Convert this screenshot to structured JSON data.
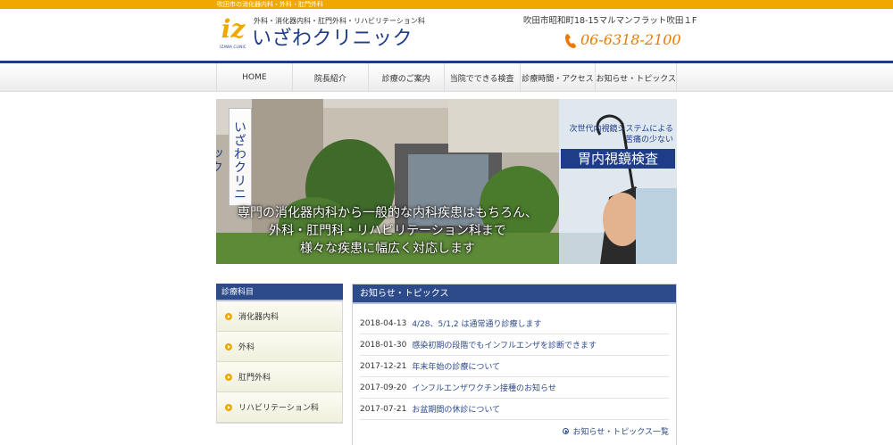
{
  "topbar": {
    "text": "吹田市の消化器内科・外科・肛門外科"
  },
  "header": {
    "logo_mark": "iz",
    "logo_en": "IZAWA CLINIC",
    "subtitle": "外科・消化器内科・肛門外科・リハビリテーション科",
    "clinic_name": "いざわクリニック",
    "address": "吹田市昭和町18-15マルマンフラット吹田１F",
    "phone": "06-6318-2100",
    "phone_icon": "phone-icon"
  },
  "colors": {
    "brand_navy": "#1e3c88",
    "accent_orange": "#f0a800",
    "phone_orange": "#ec7a00",
    "panel_header": "#2d4a8a"
  },
  "nav": {
    "items": [
      {
        "label": "HOME"
      },
      {
        "label": "院長紹介"
      },
      {
        "label": "診療のご案内"
      },
      {
        "label": "当院でできる検査"
      },
      {
        "label": "診療時間・アクセス"
      },
      {
        "label": "お知らせ・トピックス"
      }
    ]
  },
  "hero": {
    "sign": "いざわクリニック",
    "caption_lines": [
      "専門の消化器内科から一般的な内科疾患はもちろん、",
      "外科・肛門科・リハビリテーション科まで",
      "様々な疾患に幅広く対応します"
    ],
    "promo_sub_lines": [
      "次世代内視鏡システムによる",
      "苦痛の少ない"
    ],
    "promo_title": "胃内視鏡検査"
  },
  "sidebar": {
    "title": "診療科目",
    "items": [
      {
        "label": "消化器内科"
      },
      {
        "label": "外科"
      },
      {
        "label": "肛門外科"
      },
      {
        "label": "リハビリテーション科"
      }
    ]
  },
  "news": {
    "title": "お知らせ・トピックス",
    "items": [
      {
        "date": "2018-04-13",
        "title": "4/28、5/1,2 は通常通り診療します"
      },
      {
        "date": "2018-01-30",
        "title": "感染初期の段階でもインフルエンザを診断できます"
      },
      {
        "date": "2017-12-21",
        "title": "年末年始の診療について"
      },
      {
        "date": "2017-09-20",
        "title": "インフルエンザワクチン接種のお知らせ"
      },
      {
        "date": "2017-07-21",
        "title": "お盆期間の休診について"
      }
    ],
    "more_label": "お知らせ・トピックス一覧"
  }
}
